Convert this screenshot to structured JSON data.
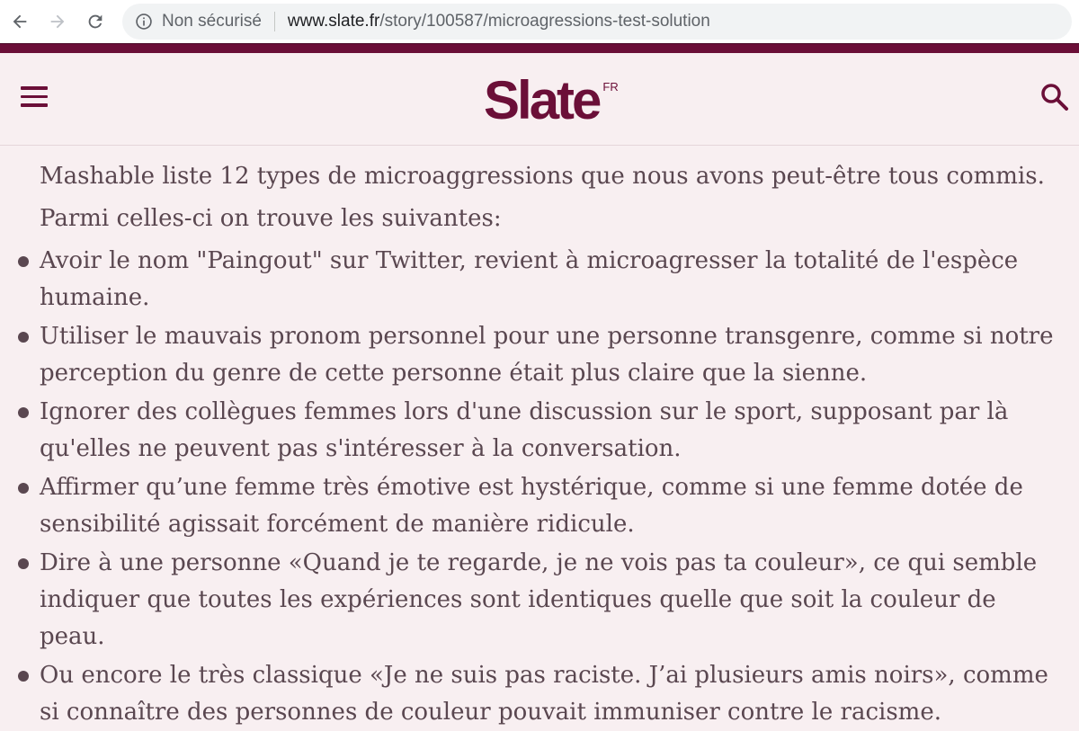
{
  "browser": {
    "security_label": "Non sécurisé",
    "url_domain": "www.slate.fr",
    "url_path": "/story/100587/microagressions-test-solution"
  },
  "site": {
    "logo": "Slate",
    "logo_suffix": "FR",
    "brand_color": "#6b0f38"
  },
  "article": {
    "intro_1": "Mashable liste 12 types de microaggressions que nous avons peut-être tous commis.",
    "intro_2": "Parmi celles-ci on trouve les suivantes:",
    "items": [
      "Avoir le nom \"Paingout\" sur Twitter, revient à microagresser la totalité de l'espèce humaine.",
      "Utiliser le mauvais pronom personnel pour une personne transgenre, comme si notre perception du genre de cette personne était plus claire que la sienne.",
      "Ignorer des collègues femmes lors d'une discussion sur le sport, supposant par là qu'elles ne peuvent pas s'intéresser à la conversation.",
      "Affirmer qu’une femme très émotive est hystérique, comme si une femme dotée de sensibilité agissait forcément de manière ridicule.",
      "Dire à une personne «Quand je te regarde, je ne vois pas ta couleur», ce qui semble indiquer que toutes les expériences sont identiques quelle que soit la couleur de peau.",
      "Ou encore le très classique «Je ne suis pas raciste. J’ai plusieurs amis noirs», comme si connaître des personnes de couleur pouvait immuniser contre le racisme."
    ]
  }
}
